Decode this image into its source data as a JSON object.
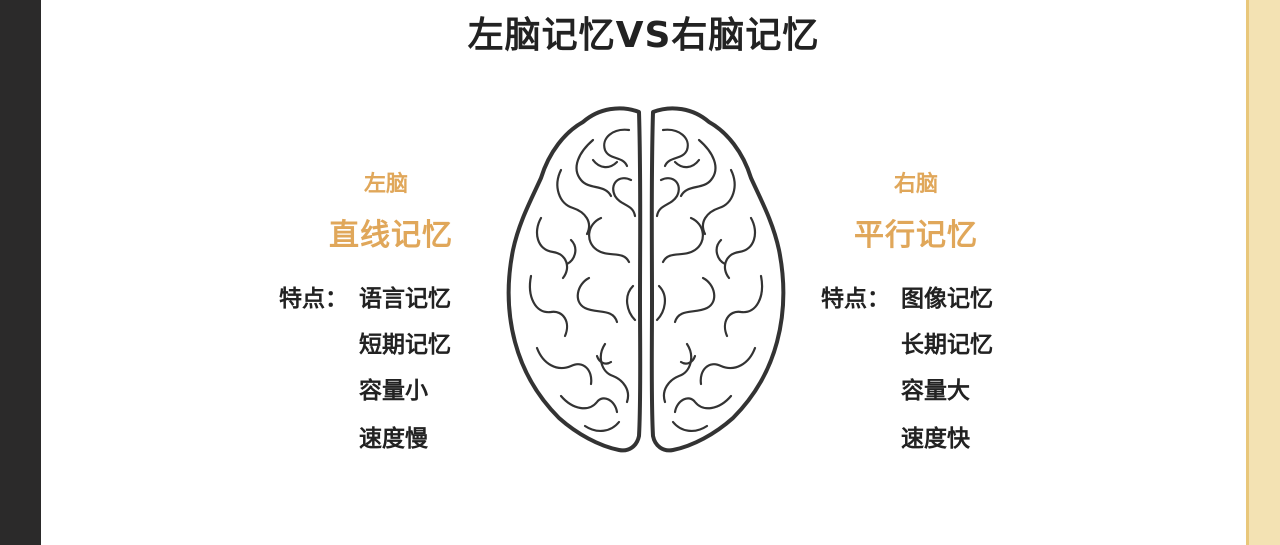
{
  "title": "左脑记忆VS右脑记忆",
  "left": {
    "hemisphere": "左脑",
    "memory_type": "直线记忆",
    "feature_label": "特点：",
    "features": [
      "语言记忆",
      "短期记忆",
      "容量小",
      "速度慢"
    ]
  },
  "right": {
    "hemisphere": "右脑",
    "memory_type": "平行记忆",
    "feature_label": "特点：",
    "features": [
      "图像记忆",
      "长期记忆",
      "容量大",
      "速度快"
    ]
  },
  "colors": {
    "accent": "#e0a75a",
    "text": "#222222",
    "left_bar": "#2b2a2a",
    "right_bar": "#f3e2b3"
  }
}
